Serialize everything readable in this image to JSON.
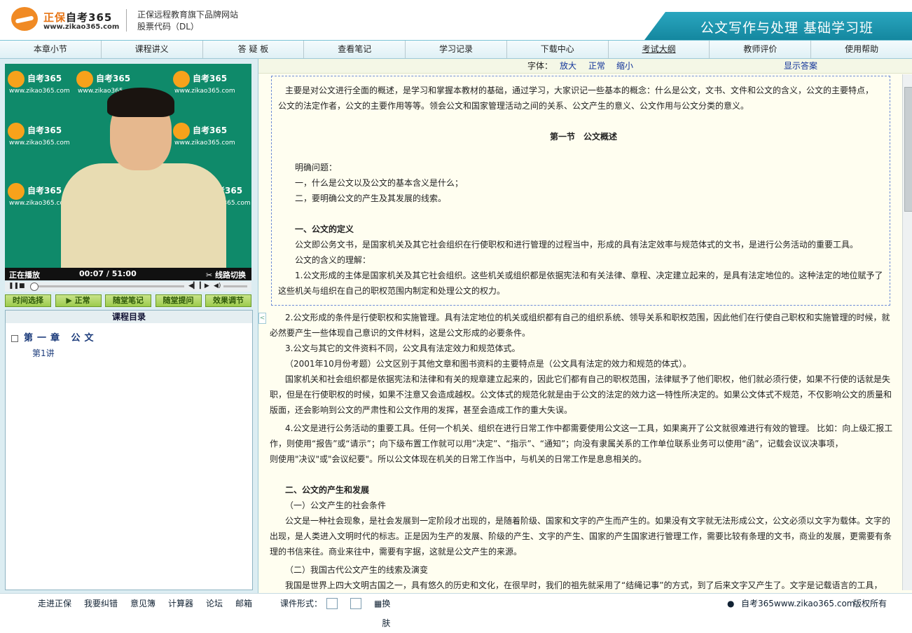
{
  "header": {
    "logo_brand": "正保",
    "logo_name": "自考365",
    "logo_url": "www.zikao365.com",
    "brand_line1": "正保远程教育旗下品牌网站",
    "brand_line2": "股票代码（DL）",
    "course_title": "公文写作与处理 基础学习班",
    "accent_color": "#1e9cb5"
  },
  "nav": [
    "本章小节",
    "课程讲义",
    "答 疑 板",
    "查看笔记",
    "学习记录",
    "下载中心",
    "考试大纲",
    "教师评价",
    "使用帮助"
  ],
  "video": {
    "status": "正在播放",
    "current_time": "00:07",
    "duration": "51:00",
    "switch_label": "线路切换",
    "watermark_name": "自考365",
    "watermark_url": "www.zikao365.com"
  },
  "player_buttons": [
    "时间选择",
    "正常",
    "随堂笔记",
    "随堂提问",
    "效果调节"
  ],
  "toc": {
    "header": "课程目录",
    "chapter": "第一章 公文",
    "lesson": "第1讲"
  },
  "toolbar": {
    "font_label": "字体：",
    "enlarge": "放大",
    "normal": "正常",
    "shrink": "缩小",
    "show_answer": "显示答案"
  },
  "content": {
    "intro1": "主要是对公文进行全面的概述，是学习和掌握本教材的基础，通过学习，大家识记一些基本的概念：什么是公文，文书、文件和公文的含义，公文的主要特点，",
    "intro2": "公文的法定作者，公文的主要作用等等。领会公文和国家管理活动之间的关系、公文产生的意义、公文作用与公文分类的意义。",
    "section1": "第一节　公文概述",
    "q_head": "明确问题：",
    "q1": "一，什么是公文以及公文的基本含义是什么；",
    "q2": "二，要明确公文的产生及其发展的线索。",
    "def_title": "一、公文的定义",
    "def_text": "公文即公务文书，是国家机关及其它社会组织在行使职权和进行管理的过程当中，形成的具有法定效率与规范体式的文书，是进行公务活动的重要工具。",
    "meaning": "公文的含义的理解：",
    "m1a": "1.公文形成的主体是国家机关及其它社会组织。这些机关或组织都是依据宪法和有关法律、章程、决定建立起来的，是具有法定地位的。这种法定的地位赋予了",
    "m1b": "这些机关与组织在自己的职权范围内制定和处理公文的权力。",
    "m2a": "2.公文形成的条件是行使职权和实施管理。具有法定地位的机关或组织都有自己的组织系统、领导关系和职权范围，因此他们在行使自己职权和实施管理的时候，就",
    "m2b": "必然要产生一些体现自己意识的文件材料，这是公文形成的必要条件。",
    "m3": "3.公文与其它的文件资料不同，公文具有法定效力和规范体式。",
    "exam": "（2001年10月份考题）公文区别于其他文章和图书资料的主要特点是（公文具有法定的效力和规范的体式）。",
    "p1a": "国家机关和社会组织都是依据宪法和法律和有关的规章建立起来的，因此它们都有自己的职权范围，法律赋予了他们职权，他们就必须行使，如果不行使的话就是失",
    "p1b": "职，但是在行使职权的时候，如果不注意又会造成越权。公文体式的规范化就是由于公文的法定的效力这一特性所决定的。如果公文体式不规范，不仅影响公文的质量和",
    "p1c": "版面，还会影响到公文的严肃性和公文作用的发挥，甚至会造成工作的重大失误。",
    "m4a": "4.公文是进行公务活动的重要工具。任何一个机关、组织在进行日常工作中都需要使用公文这一工具，如果离开了公文就很难进行有效的管理。 比如：向上级汇报工",
    "m4b": "作，则使用“报告”或“请示”；向下级布置工作就可以用“决定”、“指示”、“通知”；向没有隶属关系的工作单位联系业务可以使用“函”，记载会议议决事项，",
    "m4c": "则使用\"决议\"或\"会议纪要\"。所以公文体现在机关的日常工作当中，与机关的日常工作是息息相关的。",
    "sec2_title": "二、公文的产生和发展",
    "sub1": "（一）公文产生的社会条件",
    "s1a": "公文是一种社会现象，是社会发展到一定阶段才出现的，是随着阶级、国家和文字的产生而产生的。如果没有文字就无法形成公文，公文必须以文字为载体。文字的",
    "s1b": "出现，是人类进入文明时代的标志。正是因为生产的发展、阶级的产生、文字的产生、国家的产生国家进行管理工作，需要比较有条理的文书，商业的发展，更需要有条",
    "s1c": "理的书信来往。商业来往中，需要有字据，这就是公文产生的来源。",
    "sub2": "（二）我国古代公文产生的线索及演变",
    "s2a": "我国是世界上四大文明古国之一，具有悠久的历史和文化，在很早时，我们的祖先就采用了“结绳记事”的方式，到了后来文字又产生了。文字是记载语言的工具，"
  },
  "footer": {
    "links": [
      "走进正保",
      "我要纠错",
      "意见簿",
      "计算器",
      "论坛",
      "邮箱"
    ],
    "form_label": "课件形式：",
    "skin": "换肤",
    "site": "自考365www.zikao365.com",
    "copyright": "版权所有"
  }
}
